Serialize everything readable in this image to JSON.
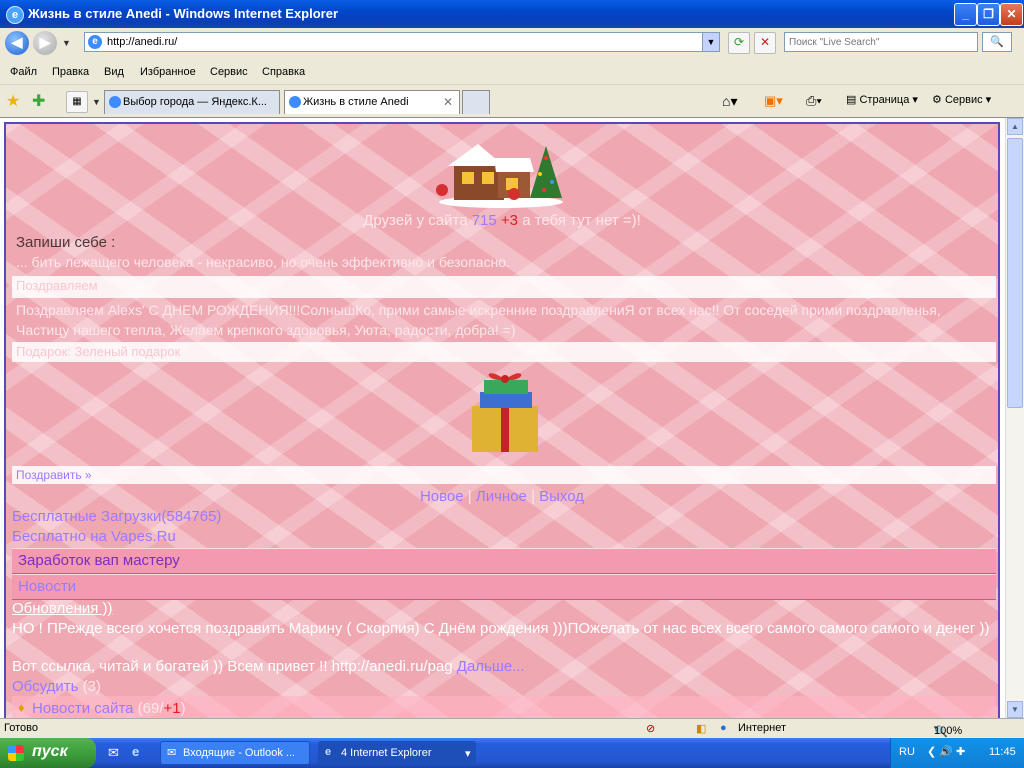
{
  "window": {
    "title": "Жизнь в стиле Anedi - Windows Internet Explorer",
    "min_label": "_",
    "max_label": "❐",
    "close_label": "✕"
  },
  "address_bar": {
    "back": "◀",
    "forward": "▶",
    "url": "http://anedi.ru/",
    "search_placeholder": "Поиск \"Live Search\""
  },
  "menu": [
    "Файл",
    "Правка",
    "Вид",
    "Избранное",
    "Сервис",
    "Справка"
  ],
  "tabs": [
    {
      "label": "Выбор города — Яндекс.К...",
      "active": false
    },
    {
      "label": "Жизнь в стиле Anedi",
      "active": true
    }
  ],
  "command_bar": {
    "page": "Страница",
    "tools": "Сервис"
  },
  "page": {
    "friends_prefix": "Друзей у сайта",
    "friends_count": "715",
    "friends_plus": "+3",
    "friends_suffix": "а тебя тут нет =)!",
    "write_label": "Запиши себе :",
    "quote": "... бить лежащего человека - некрасиво, но очень эффективно и безопасно.",
    "band1_title": "Поздравляем",
    "birthday_text": "Поздравляем Alexs' С ДНЕМ РОЖДЕНИЯ!!!СолнышКо, прими самые искренние поздравлениЯ от всех нас!! От соседей прими поздравленья, Частицу нашего тепла, Желаем крепкого здоровья, Уюта, радости, добра! =)",
    "band2_title": "Подарок: Зеленый подарок",
    "congrats_link": "Поздравить »",
    "nav_new": "Новое",
    "nav_personal": "Личное",
    "nav_exit": "Выход",
    "nav_sep": "|",
    "downloads_link": "Бесплатные Загрузки(584765)",
    "vapes_link": "Бесплатно на Vapes.Ru",
    "earn_bar": "Заработок вап мастеру",
    "news_bar": "Новости",
    "updates_link": "Обновления ))",
    "news_para": "НО ! ПРежде всего хочется поздравить Марину ( Скорпия) С Днём рождения )))ПОжелать от нас всех всего самого самого самого и денег ))",
    "news_para2": "Вот ссылка, читай и богатей )) Всем привет !! http://anedi.ru/pag",
    "more_link": "Дальше...",
    "discuss_link": "Обсудить",
    "discuss_count": "(3)",
    "site_news_link": "Новости сайта",
    "site_news_count": "(69/",
    "site_news_plus": "+1",
    "site_news_close": ")"
  },
  "status_bar": {
    "status": "Готово",
    "zone": "Интернет",
    "zoom": "100%"
  },
  "taskbar": {
    "start": "пуск",
    "items": [
      {
        "label": "Входящие - Outlook ..."
      },
      {
        "label": "4 Internet Explorer"
      }
    ],
    "lang": "RU",
    "time": "11:45"
  },
  "colors": {
    "page_bg": "#efa8b2",
    "link": "#9a7bff",
    "frame_border": "#5a49b4",
    "pink_bar": "#f39ab0"
  }
}
